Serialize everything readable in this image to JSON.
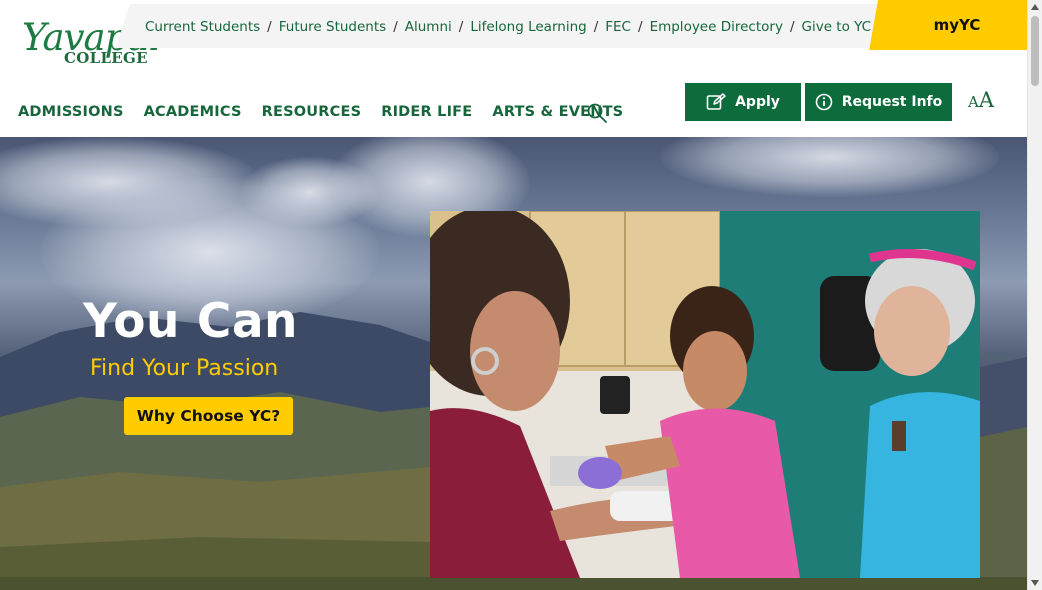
{
  "logo": {
    "name": "Yavapai",
    "sub": "COLLEGE"
  },
  "utility_links": [
    "Current Students",
    "Future Students",
    "Alumni",
    "Lifelong Learning",
    "FEC",
    "Employee Directory",
    "Give to YC"
  ],
  "utility_separator": "/",
  "myyc": "myYC",
  "main_nav": [
    "ADMISSIONS",
    "ACADEMICS",
    "RESOURCES",
    "RIDER LIFE",
    "ARTS & EVENTS"
  ],
  "buttons": {
    "apply": "Apply",
    "request_info": "Request Info"
  },
  "text_size": {
    "small": "A",
    "large": "A"
  },
  "hero": {
    "title": "You Can",
    "subtitle": "Find Your Passion",
    "cta": "Why Choose YC?"
  },
  "colors": {
    "brand_green": "#0e6b3c",
    "accent_yellow": "#ffcc00",
    "link_green": "#17663b"
  },
  "icons": [
    "search-icon",
    "edit-icon",
    "info-circle-icon"
  ]
}
